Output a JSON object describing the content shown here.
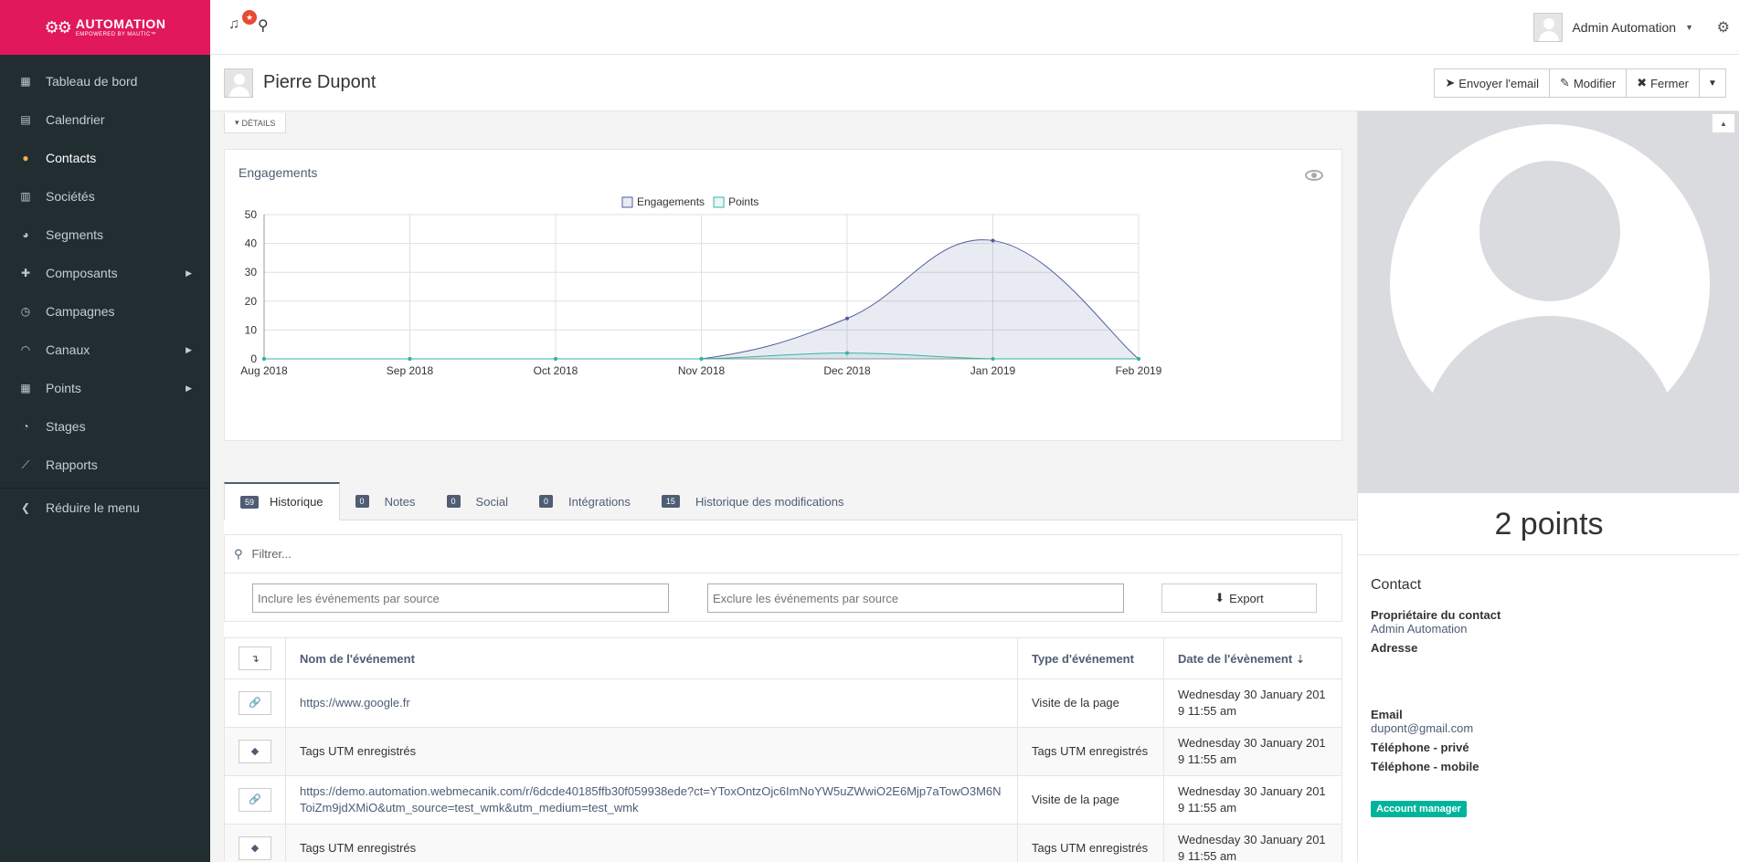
{
  "brand": {
    "title": "AUTOMATION",
    "subtitle": "EMPOWERED BY MAUTIC™"
  },
  "sidebar": {
    "items": [
      {
        "label": "Tableau de bord",
        "icon": "th-icon",
        "glyph": "▦"
      },
      {
        "label": "Calendrier",
        "icon": "calendar-icon",
        "glyph": "▤"
      },
      {
        "label": "Contacts",
        "icon": "user-icon",
        "glyph": "●",
        "active": true
      },
      {
        "label": "Sociétés",
        "icon": "building-icon",
        "glyph": "▥"
      },
      {
        "label": "Segments",
        "icon": "pie-chart-icon",
        "glyph": "◕"
      },
      {
        "label": "Composants",
        "icon": "puzzle-icon",
        "glyph": "✚",
        "submenu": true
      },
      {
        "label": "Campagnes",
        "icon": "clock-icon",
        "glyph": "◷"
      },
      {
        "label": "Canaux",
        "icon": "rss-icon",
        "glyph": "◠",
        "submenu": true
      },
      {
        "label": "Points",
        "icon": "calculator-icon",
        "glyph": "▦",
        "submenu": true
      },
      {
        "label": "Stages",
        "icon": "tachometer-icon",
        "glyph": "◔"
      },
      {
        "label": "Rapports",
        "icon": "line-chart-icon",
        "glyph": "⟋"
      }
    ],
    "collapse_label": "Réduire le menu",
    "submenu_caret": "▶",
    "collapse_glyph": "❮"
  },
  "topbar": {
    "notification_count": "★",
    "user_name": "Admin Automation",
    "caret": "▼",
    "gear_glyph": "⚙",
    "bell_glyph": "♫",
    "search_glyph": "⚲"
  },
  "header": {
    "title": "Pierre Dupont",
    "buttons": {
      "send_email": "Envoyer l'email",
      "edit": "Modifier",
      "close": "Fermer",
      "more_caret": "▼",
      "send_glyph": "➤",
      "edit_glyph": "✎",
      "close_glyph": "✖"
    }
  },
  "details_toggle": {
    "label": "DÉTAILS",
    "caret": "▾"
  },
  "chart_data": {
    "type": "line",
    "title": "Engagements",
    "x": [
      "Aug 2018",
      "Sep 2018",
      "Oct 2018",
      "Nov 2018",
      "Dec 2018",
      "Jan 2019",
      "Feb 2019"
    ],
    "series": [
      {
        "name": "Engagements",
        "values": [
          0,
          0,
          0,
          0,
          14,
          41,
          0
        ],
        "color": "#4e5d9d",
        "fill": "rgba(78,93,157,0.12)"
      },
      {
        "name": "Points",
        "values": [
          0,
          0,
          0,
          0,
          2,
          0,
          0
        ],
        "color": "#35b5a0",
        "fill": "rgba(53,181,160,0.10)"
      }
    ],
    "ylim": [
      0,
      50
    ],
    "yticks": [
      0,
      10,
      20,
      30,
      40,
      50
    ],
    "grid": true,
    "legend": "top"
  },
  "tabs": [
    {
      "count": "59",
      "label": "Historique",
      "active": true
    },
    {
      "count": "0",
      "label": "Notes"
    },
    {
      "count": "0",
      "label": "Social"
    },
    {
      "count": "0",
      "label": "Intégrations"
    },
    {
      "count": "15",
      "label": "Historique des modifications"
    }
  ],
  "filter": {
    "placeholder": "Filtrer...",
    "include_placeholder": "Inclure les événements par source",
    "exclude_placeholder": "Exclure les événements par source",
    "export_label": "Export",
    "search_glyph": "⚲",
    "export_glyph": "⬇"
  },
  "table": {
    "headers": {
      "toggle": "↴",
      "name": "Nom de l'événement",
      "type": "Type d'événement",
      "date": "Date de l'évènement",
      "sort_glyph": "⇣"
    },
    "rows": [
      {
        "icon": "link-icon",
        "glyph": "🔗",
        "name": "https://www.google.fr",
        "is_link": true,
        "type": "Visite de la page",
        "date": "Wednesday 30 January 2019 11:55 am"
      },
      {
        "icon": "tag-icon",
        "glyph": "◆",
        "name": "Tags UTM enregistrés",
        "is_link": false,
        "type": "Tags UTM enregistrés",
        "date": "Wednesday 30 January 2019 11:55 am"
      },
      {
        "icon": "link-icon",
        "glyph": "🔗",
        "name": "https://demo.automation.webmecanik.com/r/6dcde40185ffb30f059938ede?ct=YToxOntzOjc6ImNoYW5uZWwiO2E6Mjp7aTowO3M6NToiZm9jdXMiO&utm_source=test_wmk&utm_medium=test_wmk",
        "is_link": true,
        "type": "Visite de la page",
        "date": "Wednesday 30 January 2019 11:55 am"
      },
      {
        "icon": "tag-icon",
        "glyph": "◆",
        "name": "Tags UTM enregistrés",
        "is_link": false,
        "type": "Tags UTM enregistrés",
        "date": "Wednesday 30 January 2019 11:55 am"
      }
    ]
  },
  "right_panel": {
    "points": "2 points",
    "collapse_glyph": "▲",
    "contact_heading": "Contact",
    "owner_label": "Propriétaire du contact",
    "owner_value": "Admin Automation",
    "address_label": "Adresse",
    "email_label": "Email",
    "email_value": "dupont@gmail.com",
    "phone_private_label": "Téléphone - privé",
    "phone_mobile_label": "Téléphone - mobile",
    "tag": "Account manager"
  }
}
